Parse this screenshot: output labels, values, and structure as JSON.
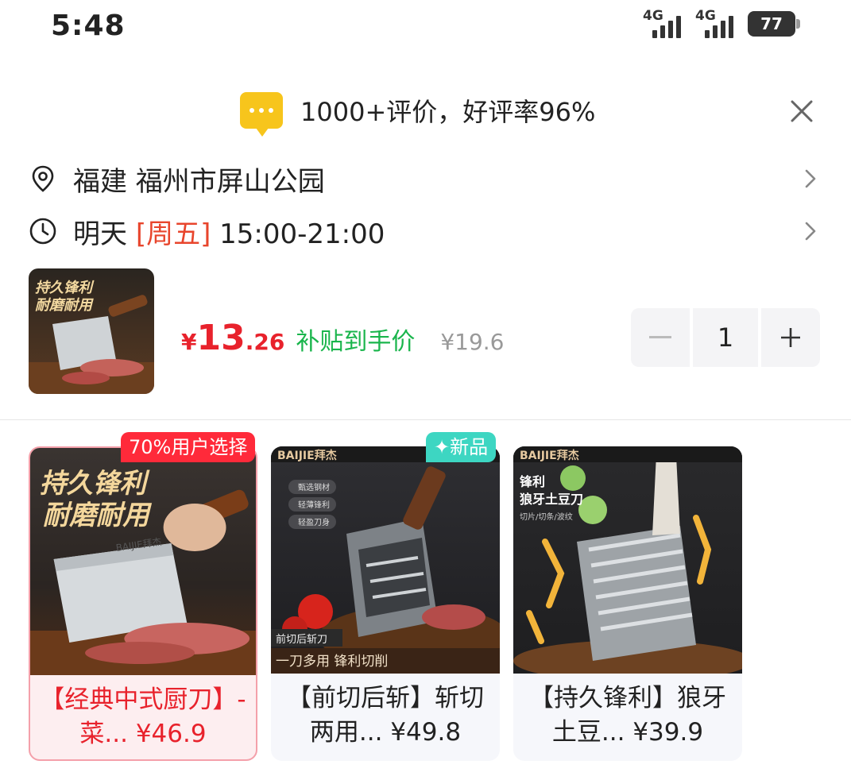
{
  "status_bar": {
    "time": "5:48",
    "network_1": "4G",
    "network_2": "4G",
    "battery": "77"
  },
  "review": {
    "text": "1000+评价，好评率96%",
    "icon": "chat-bubble-icon"
  },
  "address": {
    "text": "福建  福州市屏山公园",
    "icon": "location-pin-icon"
  },
  "delivery": {
    "prefix": "明天 ",
    "day": "[周五]",
    "time": " 15:00-21:00",
    "icon": "clock-icon"
  },
  "product": {
    "thumb_text_1": "持久锋利",
    "thumb_text_2": "耐磨耐用",
    "price_symbol": "¥",
    "price_int": "13",
    "price_dec": ".26",
    "price_label": "补贴到手价",
    "original_price": "¥19.6",
    "quantity": "1"
  },
  "recommendations": [
    {
      "badge": "70%用户选择",
      "img_text_1": "持久锋利",
      "img_text_2": "耐磨耐用",
      "brand": "BAIJIE拜杰",
      "title": "【经典中式厨刀】-菜...",
      "price": "¥46.9",
      "selected": true
    },
    {
      "badge": "✦新品",
      "brand": "BAIJIE拜杰",
      "tags": [
        "甄选钢材",
        "轻薄锋利",
        "轻盈刀身"
      ],
      "sub_label": "前切后斩刀",
      "banner": "一刀多用 锋利切削",
      "title": "【前切后斩】斩切两用...",
      "price": "¥49.8",
      "selected": false
    },
    {
      "brand": "BAIJIE拜杰",
      "img_text_1": "锋利",
      "img_text_2": "狼牙土豆刀",
      "img_text_3": "切片/切条/波纹",
      "title": "【持久锋利】狼牙土豆...",
      "price": "¥39.9",
      "selected": false
    }
  ],
  "colors": {
    "price_red": "#e8222c",
    "subsidy_green": "#1ab54c",
    "highlight_red": "#e8452c",
    "badge_red": "#ff2a3a",
    "badge_teal": "#3dd6c2",
    "chat_yellow": "#f7c51c"
  }
}
